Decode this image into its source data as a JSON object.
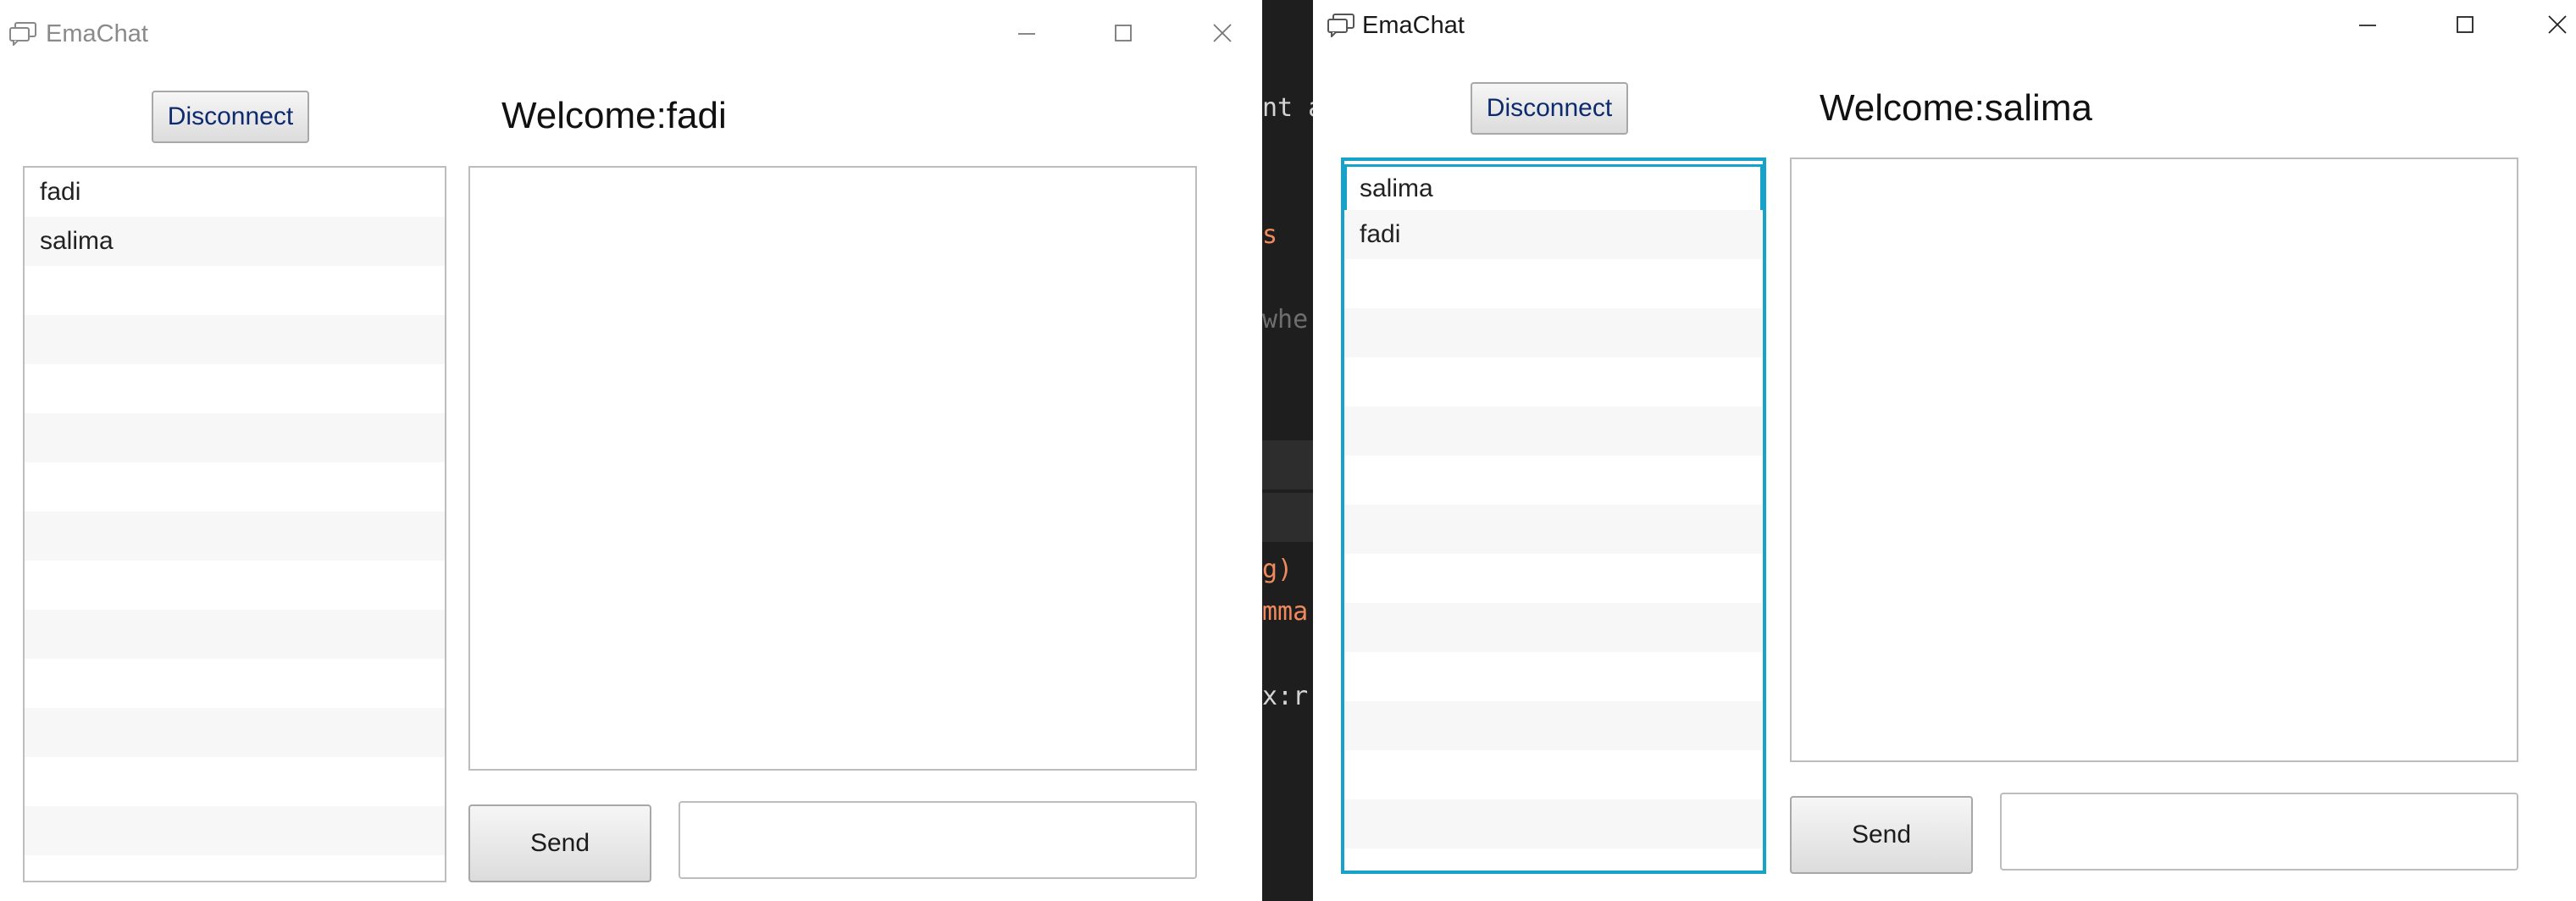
{
  "background_editor": {
    "lines": [
      "nt a",
      "s",
      "whe",
      "g)",
      "mma",
      "x:r"
    ],
    "code_colors": {
      "default": "#d4d4d4",
      "accent": "#f08a5d"
    }
  },
  "windows": [
    {
      "title": "EmaChat",
      "disconnect_label": "Disconnect",
      "welcome": "Welcome:fadi",
      "users": [
        "fadi",
        "salima"
      ],
      "send_label": "Send",
      "message_value": "",
      "focused_list": false
    },
    {
      "title": "EmaChat",
      "disconnect_label": "Disconnect",
      "welcome": "Welcome:salima",
      "users": [
        "salima",
        "fadi"
      ],
      "selected_user": "salima",
      "send_label": "Send",
      "message_value": "",
      "focused_list": true
    }
  ],
  "icons": {
    "app": "chat-bubbles-icon",
    "minimize": "minimize-icon",
    "maximize": "maximize-icon",
    "close": "close-icon"
  },
  "colors": {
    "focus_accent": "#17a2c9",
    "disconnect_text": "#0e2a6e",
    "list_stripe": "#f7f7f7"
  }
}
